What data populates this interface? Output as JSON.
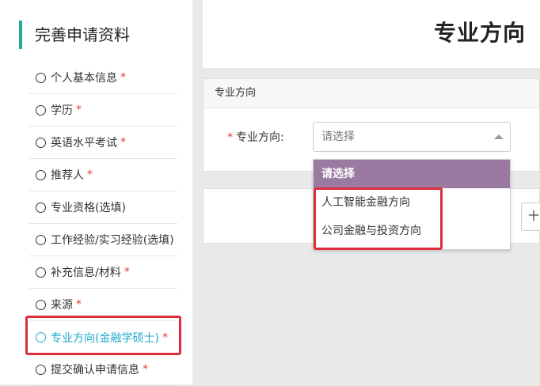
{
  "sidebar": {
    "title": "完善申请资料",
    "items": [
      {
        "label": "个人基本信息",
        "required": "*"
      },
      {
        "label": "学历",
        "required": "*"
      },
      {
        "label": "英语水平考试",
        "required": "*"
      },
      {
        "label": "推荐人",
        "required": "*"
      },
      {
        "label": "专业资格(选填)",
        "required": ""
      },
      {
        "label": "工作经验/实习经验(选填)",
        "required": ""
      },
      {
        "label": "补充信息/材料",
        "required": "*"
      },
      {
        "label": "来源",
        "required": "*"
      },
      {
        "label": "专业方向(金融学硕士)",
        "required": "*"
      },
      {
        "label": "提交确认申请信息",
        "required": "*"
      }
    ],
    "active_index": 8
  },
  "header": {
    "title": "专业方向"
  },
  "section": {
    "heading": "专业方向",
    "field": {
      "required_mark": "*",
      "label": "专业方向:",
      "placeholder": "请选择"
    }
  },
  "dropdown": {
    "options": [
      "请选择",
      "人工智能金融方向",
      "公司金融与投资方向"
    ],
    "selected_index": 0
  },
  "card2": {
    "button_label": "十"
  },
  "colors": {
    "accent": "#26a69a",
    "active_link": "#1ea8d0",
    "required": "#e53935",
    "highlight_box": "#e02d3c",
    "option_selected": "#9a7aa0"
  }
}
